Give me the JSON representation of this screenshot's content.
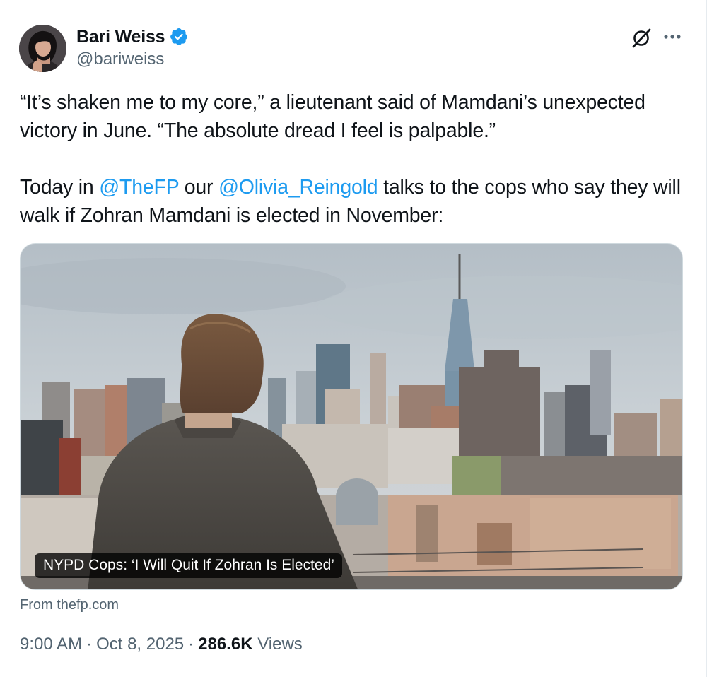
{
  "author": {
    "display_name": "Bari Weiss",
    "handle": "@bariweiss",
    "verified": true,
    "verified_color": "#1d9bf0"
  },
  "actions": {
    "grok_icon": "grok-icon",
    "more_icon": "more-icon"
  },
  "tweet": {
    "paragraph1": "“It’s shaken me to my core,” a lieutenant said of Mamdani’s unexpected victory in June. “The absolute dread I feel is palpable.”",
    "p2_before": "Today in ",
    "mention1": "@TheFP",
    "p2_middle": " our ",
    "mention2": "@Olivia_Reingold",
    "p2_after": " talks to the cops who say they will walk if Zohran Mamdani is elected in November:"
  },
  "card": {
    "title": "NYPD Cops: ‘I Will Quit If Zohran Is Elected’",
    "source": "From thefp.com"
  },
  "meta": {
    "time": "9:00 AM",
    "date": "Oct 8, 2025",
    "views_count": "286.6K",
    "views_label": "Views"
  },
  "colors": {
    "link": "#1d9bf0",
    "secondary_text": "#536471",
    "primary_text": "#0f1419"
  }
}
